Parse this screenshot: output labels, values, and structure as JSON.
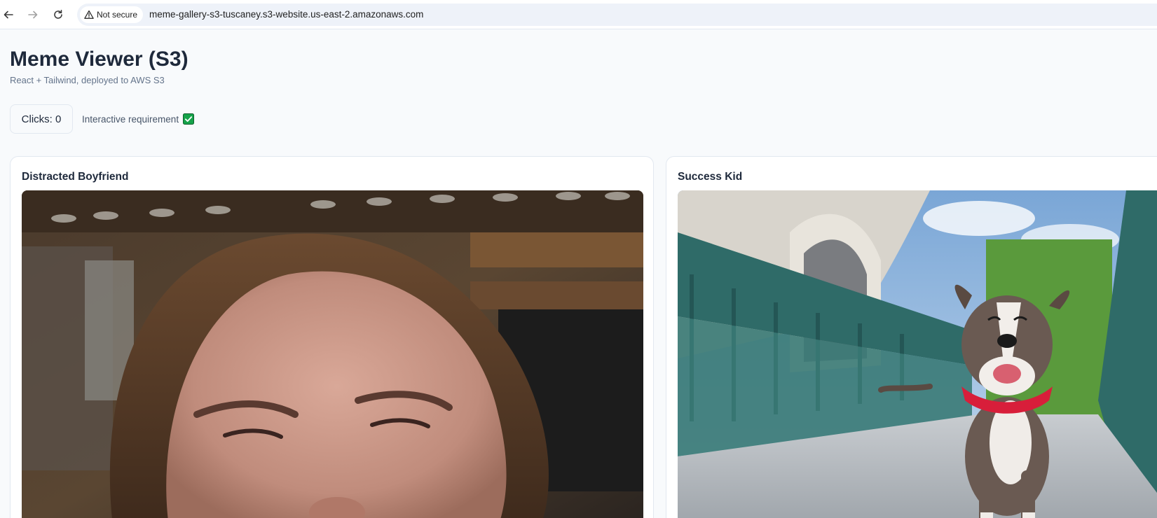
{
  "browser": {
    "security_label": "Not secure",
    "url": "meme-gallery-s3-tuscaney.s3-website.us-east-2.amazonaws.com"
  },
  "page": {
    "title": "Meme Viewer (S3)",
    "subtitle": "React + Tailwind, deployed to AWS S3"
  },
  "controls": {
    "clicks_label": "Clicks: 0",
    "requirement_label": "Interactive requirement"
  },
  "memes": [
    {
      "title": "Distracted Boyfriend"
    },
    {
      "title": "Success Kid"
    }
  ],
  "colors": {
    "background": "#f8fafc",
    "text": "#1e293b",
    "muted": "#64748b",
    "check": "#22c55e"
  }
}
